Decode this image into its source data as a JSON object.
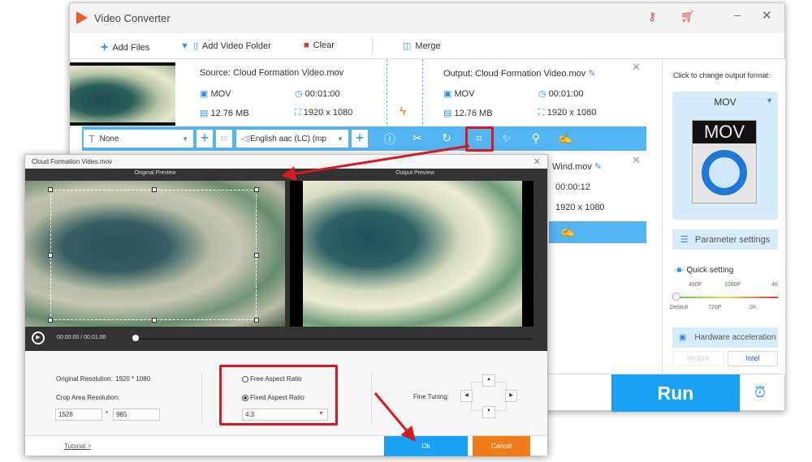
{
  "app": {
    "title": "Video Converter"
  },
  "toolbar": {
    "add_files": "Add Files",
    "add_folder": "Add Video Folder",
    "clear": "Clear",
    "merge": "Merge"
  },
  "file1": {
    "source": "Source: Cloud Formation Video.mov",
    "output": "Output: Cloud Formation Video.mov",
    "src_format": "MOV",
    "src_duration": "00:01:00",
    "src_size": "12.76 MB",
    "src_resolution": "1920 x 1080",
    "out_format": "MOV",
    "out_duration": "00:01:00",
    "out_size": "12.76 MB",
    "out_resolution": "1920 x 1080",
    "subtitle": "None",
    "audio": "English aac (LC) (mp"
  },
  "file2": {
    "output": "Wind.mov",
    "duration": "00:00:12",
    "resolution": "1920 x 1080"
  },
  "right_panel": {
    "hint": "Click to change output format:",
    "format": "MOV",
    "format_icon_text": "MOV",
    "param_settings": "Parameter settings",
    "quick_setting": "Quick setting",
    "levels_top": [
      "480P",
      "1080P",
      "4K"
    ],
    "levels_bottom": [
      "Default",
      "720P",
      "2K"
    ],
    "quick_level": "Default",
    "hw_accel": "Hardware acceleration",
    "nvidia": "NVIDIA",
    "intel": "Intel",
    "run": "Run"
  },
  "dialog": {
    "title": "Cloud Formation Video.mov",
    "original_preview": "Original Preview",
    "output_preview": "Output Preview",
    "time_current": "00:00:00",
    "time_sep": "/",
    "time_total": "00:01:00",
    "playback_progress": 0,
    "orig_res_label": "Original Resolution:",
    "orig_res": "1920 * 1080",
    "crop_res_label": "Crop Area Resolution:",
    "crop_w": "1528",
    "crop_sep": "*",
    "crop_h": "965",
    "free_ratio": "Free Aspect Ratio",
    "fixed_ratio": "Fixed Aspect Ratio",
    "ratio_selected": "Fixed Aspect Ratio",
    "ratio_value": "4:3",
    "fine_tuning": "Fine Tuning:",
    "tutorial": "Tutorial >",
    "ok": "Ok",
    "cancel": "Cancel"
  },
  "colors": {
    "accent": "#55b4f2",
    "run": "#1aa0f5",
    "cancel": "#f07d1a",
    "annotation": "#d71920"
  }
}
